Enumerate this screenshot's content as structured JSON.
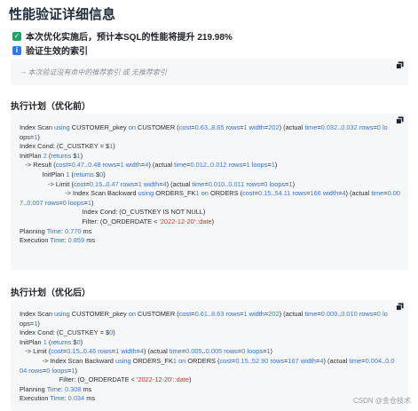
{
  "page": {
    "title": "性能验证详细信息"
  },
  "summary": {
    "performance_line": "本次优化实施后，预计本SQL的性能将提升 219.98%",
    "verified_index_heading": "验证生效的索引"
  },
  "index_note": {
    "text": "-- 本次验证没有命中的推荐索引 或 无推荐索引"
  },
  "plan_before": {
    "heading": "执行计划（优化前）",
    "lines": [
      "Index Scan using CUSTOMER_pkey on CUSTOMER  (cost=0.63..8.65 rows=1 width=202) (actual time=0.032..0.032 rows=0 lo",
      "ops=1)",
      "Index Cond: (C_CUSTKEY = $1)",
      "InitPlan 2 (returns $1)",
      "  ->  Result  (cost=0.47..0.48 rows=1 width=4) (actual time=0.012..0.012 rows=1 loops=1)",
      "        InitPlan 1 (returns $0)",
      "          ->  Limit  (cost=0.15..0.47 rows=1 width=4) (actual time=0.010..0.011 rows=0 loops=1)",
      "                ->  Index Scan Backward using ORDERS_FK1 on ORDERS  (cost=0.15..54.11 rows=166 width=4) (actual time=0.00",
      "7..0.007 rows=0 loops=1)",
      "                      Index Cond: (O_CUSTKEY IS NOT NULL)",
      "                      Filter: (O_ORDERDATE < '2022-12-20'::date)",
      "Planning Time: 0.770 ms",
      "Execution Time: 0.859 ms"
    ]
  },
  "plan_after": {
    "heading": "执行计划（优化后）",
    "lines": [
      "Index Scan using CUSTOMER_pkey on CUSTOMER  (cost=0.61..8.63 rows=1 width=202) (actual time=0.009..0.010 rows=0 lo",
      "ops=1)",
      "Index Cond: (C_CUSTKEY = $0)",
      "InitPlan 1 (returns $0)",
      "  ->  Limit  (cost=0.15..0.46 rows=1 width=4) (actual time=0.005..0.005 rows=0 loops=1)",
      "        ->  Index Scan Backward using ORDERS_FK1 on ORDERS  (cost=0.15..52.90 rows=167 width=4) (actual time=0.004..0.0",
      "04 rows=0 loops=1)",
      "              Filter: (O_ORDERDATE < '2022-12-20'::date)",
      "Planning Time: 0.308 ms",
      "Execution Time: 0.034 ms"
    ]
  },
  "watermark": {
    "text": "CSDN @金仓技术"
  },
  "icons": {
    "success": "check-square-icon",
    "info": "info-square-icon",
    "copy": "copy-icon"
  },
  "colors": {
    "success_green": "#21a366",
    "info_blue": "#2f7be5",
    "keyword_blue": "#2f6fd6",
    "string_red": "#c0392b"
  }
}
